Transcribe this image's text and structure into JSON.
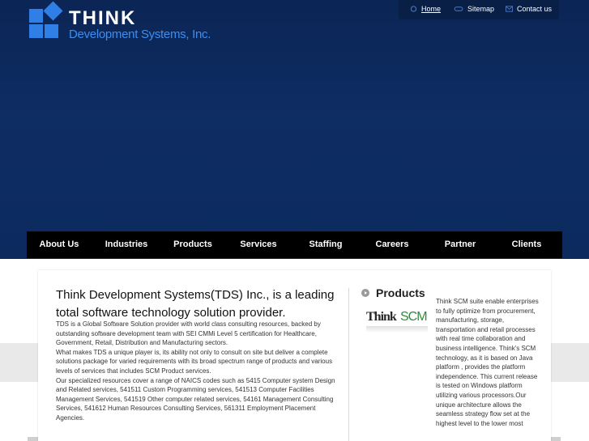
{
  "brand": {
    "title": "THINK",
    "subtitle": "Development Systems, Inc."
  },
  "top_links": [
    {
      "label": "Home",
      "icon": "home-icon"
    },
    {
      "label": "Sitemap",
      "icon": "sitemap-icon"
    },
    {
      "label": "Contact us",
      "icon": "mail-icon"
    }
  ],
  "nav": [
    {
      "label": "About  Us"
    },
    {
      "label": "Industries"
    },
    {
      "label": "Products"
    },
    {
      "label": "Services"
    },
    {
      "label": "Staffing"
    },
    {
      "label": "Careers"
    },
    {
      "label": "Partner"
    },
    {
      "label": "Clients"
    }
  ],
  "main": {
    "headline": "Think Development Systems(TDS) Inc., is a leading total software technology solution provider.",
    "paragraphs": [
      "TDS is a Global Software Solution provider with world class consulting resources, backed by outstanding software development team with SEI CMMi Level 5 certification for Healthcare, Government, Retail, Distribution and Manufacturing sectors.",
      "What makes TDS a unique player is, its ability not only to consult on site but deliver a complete solutions package for varied requirements with its broad spectrum range of products and various levels of services that includes SCM Product services.",
      "Our specialized resources cover a range of NAICS codes such as 5415 Computer system Design and Related services, 541511 Custom Programming services, 541513 Computer Facilities Management Services, 541519 Other computer related services, 54161 Management Consulting Services, 541612 Human Resources Consulting Services, 561311 Employment Placement Agencies."
    ]
  },
  "products": {
    "heading": "Products",
    "logo_part1": "Think",
    "logo_part2": "SCM",
    "description": "Think SCM suite enable enterprises to fully optimize from procurement, manufacturing, storage, transportation and retail processes with real time collaboration and business intelligence. Think's SCM technology, as it is based on Java platform , provides the platform independence. This current release is tested on Windows platform utilizing various processors.Our unique architecture allows the seamless strategy flow set at the highest level to the lower most"
  },
  "colors": {
    "header_bg": "#0c2a5c",
    "accent_blue": "#2f7fe6",
    "nav_bg": "#000000",
    "scm_green": "#2f8a3a"
  }
}
